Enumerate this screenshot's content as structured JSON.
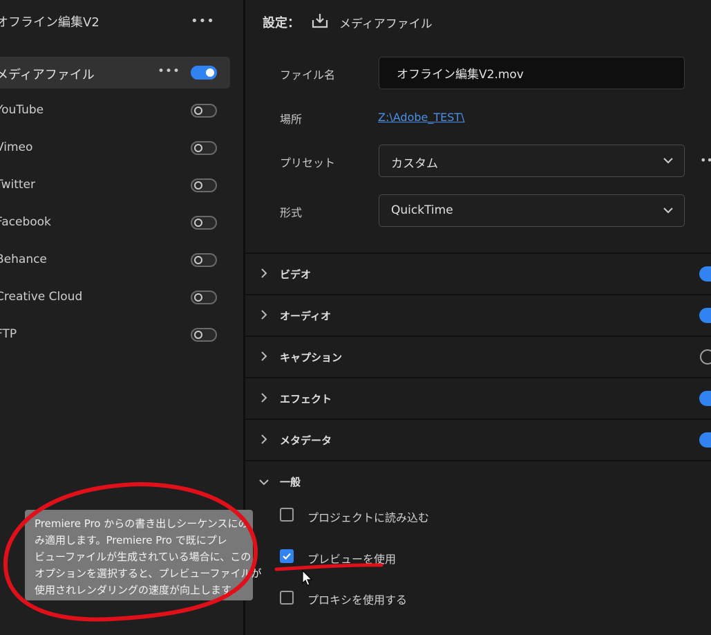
{
  "left_panel": {
    "title": "オフライン編集V2",
    "more": "•••",
    "destinations": [
      {
        "label": "メディアファイル",
        "enabled": true
      },
      {
        "label": "YouTube",
        "enabled": false
      },
      {
        "label": "Vimeo",
        "enabled": false
      },
      {
        "label": "Twitter",
        "enabled": false
      },
      {
        "label": "Facebook",
        "enabled": false
      },
      {
        "label": "Behance",
        "enabled": false
      },
      {
        "label": "Creative Cloud",
        "enabled": false
      },
      {
        "label": "FTP",
        "enabled": false
      }
    ]
  },
  "settings": {
    "header": "設定：",
    "title": "メディアファイル",
    "icon": "download-icon",
    "file_name_label": "ファイル名",
    "file_name_value": "オフライン編集V2.mov",
    "location_label": "場所",
    "location_value": "Z:\\Adobe_TEST\\",
    "preset_label": "プリセット",
    "preset_value": "カスタム",
    "format_label": "形式",
    "format_value": "QuickTime",
    "side_more": "••"
  },
  "sections": [
    {
      "label": "ビデオ",
      "enabled": true
    },
    {
      "label": "オーディオ",
      "enabled": true
    },
    {
      "label": "キャプション",
      "enabled": false
    },
    {
      "label": "エフェクト",
      "enabled": true
    },
    {
      "label": "メタデータ",
      "enabled": true
    }
  ],
  "general": {
    "label": "一般",
    "options": [
      {
        "label": "プロジェクトに読み込む",
        "checked": false
      },
      {
        "label": "プレビューを使用",
        "checked": true
      },
      {
        "label": "プロキシを使用する",
        "checked": false
      }
    ]
  },
  "tooltip": {
    "lines": [
      "Premiere Pro からの書き出しシーケンスにの",
      "み適用します。Premiere Pro で既にプレ",
      "ビューファイルが生成されている場合に、この",
      "オプションを選択すると、プレビューファイルが",
      "使用されレンダリングの速度が向上します。"
    ]
  },
  "colors": {
    "accent": "#3183f2",
    "annotation": "#e0101a",
    "link": "#4a90e8"
  }
}
